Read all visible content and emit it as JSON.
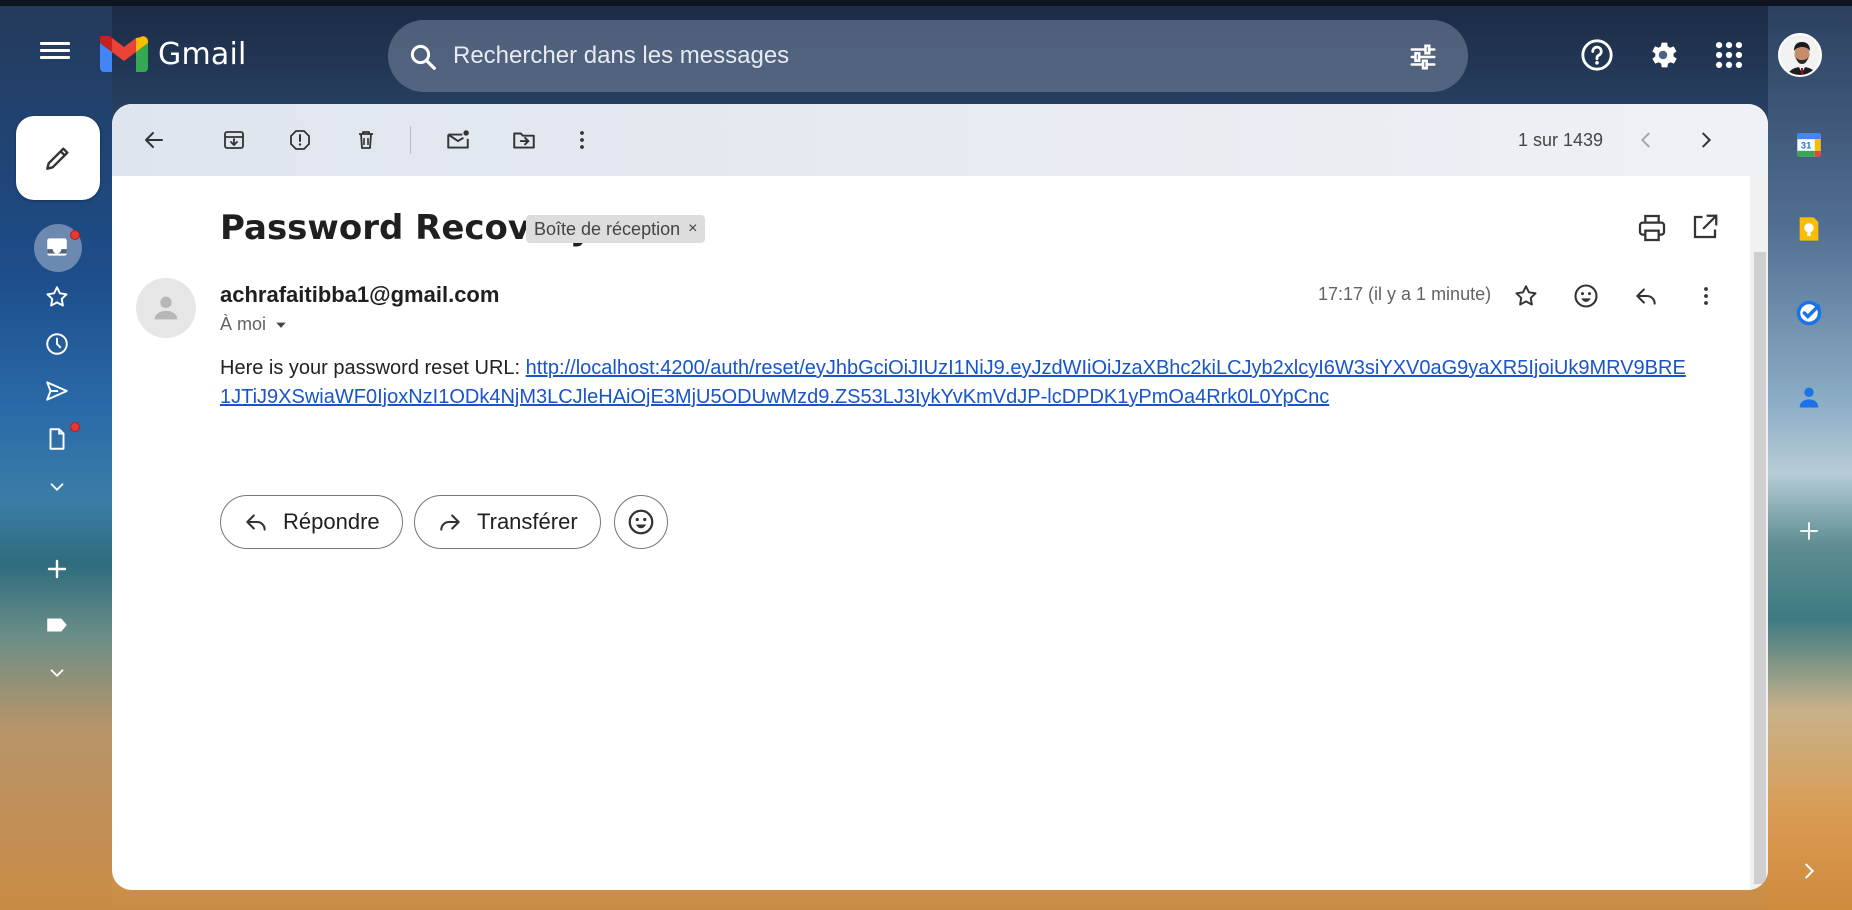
{
  "app": {
    "title": "Gmail"
  },
  "search": {
    "placeholder": "Rechercher dans les messages"
  },
  "toolbar": {
    "pager": "1 sur 1439"
  },
  "email": {
    "subject": "Password Recovery",
    "label": "Boîte de réception",
    "label_close": "×",
    "sender": "achrafaitibba1@gmail.com",
    "to": "À moi",
    "time": "17:17 (il y a 1 minute)",
    "body_prefix": "Here is your password reset URL: ",
    "body_link": "http://localhost:4200/auth/reset/eyJhbGciOiJIUzI1NiJ9.eyJzdWIiOiJzaXBhc2kiLCJyb2xlcyI6W3siYXV0aG9yaXR5IjoiUk9MRV9BRE1JTiJ9XSwiaWF0IjoxNzI1ODk4NjM3LCJleHAiOjE3MjU5ODUwMzd9.ZS53LJ3IykYvKmVdJP-lcDPDK1yPmOa4Rrk0L0YpCnc"
  },
  "actions": {
    "reply": "Répondre",
    "forward": "Transférer"
  },
  "icons": {
    "menu": "hamburger-icon",
    "help": "help-icon",
    "settings": "gear-icon",
    "apps": "apps-grid-icon",
    "calendar_day": "31"
  },
  "colors": {
    "gmail_red": "#ea4335",
    "gmail_blue": "#4285f4",
    "gmail_green": "#34a853",
    "gmail_yellow": "#fbbc04",
    "link": "#1a55c7"
  }
}
